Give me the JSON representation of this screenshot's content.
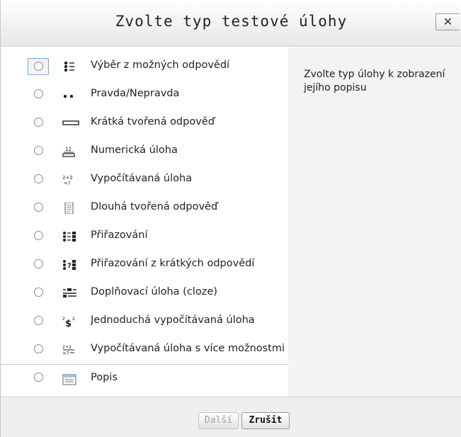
{
  "dialog": {
    "title": "Zvolte typ testové úlohy",
    "close_label": "✕"
  },
  "options": [
    {
      "label": "Výběr z možných odpovědí",
      "icon": "multichoice-icon"
    },
    {
      "label": "Pravda/Nepravda",
      "icon": "truefalse-icon"
    },
    {
      "label": "Krátká tvořená odpověď",
      "icon": "shortanswer-icon"
    },
    {
      "label": "Numerická úloha",
      "icon": "numerical-icon"
    },
    {
      "label": "Vypočítávaná úloha",
      "icon": "calculated-icon"
    },
    {
      "label": "Dlouhá tvořená odpověď",
      "icon": "essay-icon"
    },
    {
      "label": "Přiřazování",
      "icon": "matching-icon"
    },
    {
      "label": "Přiřazování z krátkých odpovědí",
      "icon": "randomsamatch-icon"
    },
    {
      "label": "Doplňovací úloha (cloze)",
      "icon": "cloze-icon"
    },
    {
      "label": "Jednoduchá vypočítávaná úloha",
      "icon": "calculatedsimple-icon"
    },
    {
      "label": "Vypočítávaná úloha s více možnostmi",
      "icon": "calculatedmulti-icon"
    },
    {
      "label": "Popis",
      "icon": "description-icon"
    }
  ],
  "description": {
    "text": "Zvolte typ úlohy k zobrazení jejího popisu"
  },
  "footer": {
    "next_label": "Další",
    "cancel_label": "Zrušit"
  }
}
